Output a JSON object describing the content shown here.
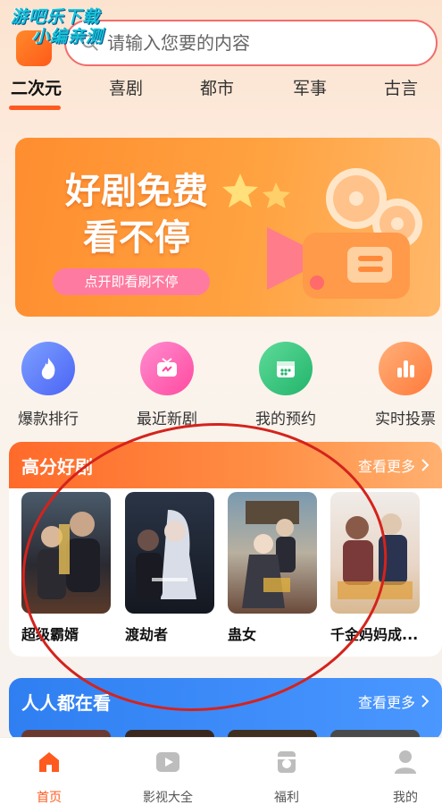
{
  "watermark": {
    "line1": "游吧乐下载",
    "line2": "小编亲测"
  },
  "search": {
    "placeholder": "请输入您要的内容"
  },
  "tabs": [
    {
      "label": "二次元",
      "active": true
    },
    {
      "label": "喜剧"
    },
    {
      "label": "都市"
    },
    {
      "label": "军事"
    },
    {
      "label": "古言"
    }
  ],
  "banner": {
    "title_line1": "好剧免费",
    "title_line2": "看不停",
    "button": "点开即看刷不停"
  },
  "quick": [
    {
      "label": "爆款排行",
      "icon": "flame-icon",
      "color": "#5b7cff"
    },
    {
      "label": "最近新剧",
      "icon": "tv-icon",
      "color": "#ff5fa8"
    },
    {
      "label": "我的预约",
      "icon": "calendar-icon",
      "color": "#35c27a"
    },
    {
      "label": "实时投票",
      "icon": "bar-chart-icon",
      "color": "#ff8a4c"
    }
  ],
  "section_top": {
    "title": "高分好剧",
    "more": "查看更多",
    "items": [
      {
        "name": "超级霸婿"
      },
      {
        "name": "渡劫者"
      },
      {
        "name": "蛊女"
      },
      {
        "name": "千金妈妈成..."
      }
    ]
  },
  "section_people": {
    "title": "人人都在看",
    "more": "查看更多"
  },
  "nav": [
    {
      "label": "首页",
      "active": true,
      "icon": "home-icon"
    },
    {
      "label": "影视大全",
      "icon": "play-icon"
    },
    {
      "label": "福利",
      "icon": "gift-icon"
    },
    {
      "label": "我的",
      "icon": "user-icon"
    }
  ],
  "colors": {
    "accent": "#ff5a1f",
    "search_border": "#f26c6c",
    "section_blue": "#2f7ff2"
  }
}
